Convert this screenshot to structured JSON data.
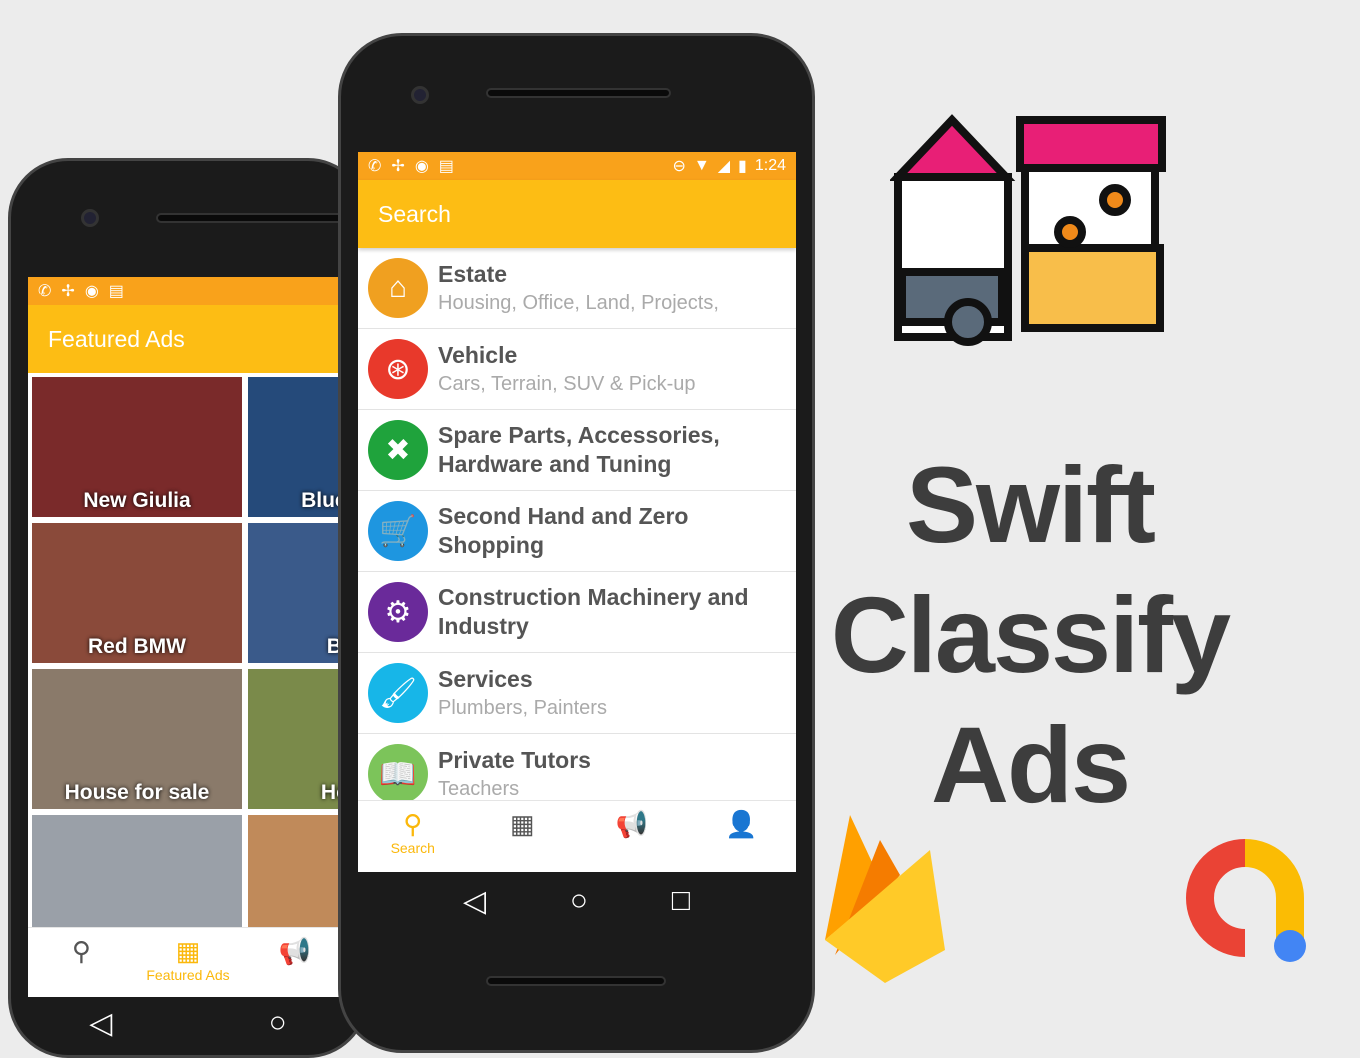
{
  "back_phone": {
    "status_icons": [
      "missed-call-icon",
      "pinwheel-icon",
      "android-icon",
      "news-icon"
    ],
    "appbar_title": "Featured Ads",
    "tiles": [
      {
        "label": "New Giulia",
        "color": "#7a2a2a"
      },
      {
        "label": "Blue BMW",
        "color": "#254a7a"
      },
      {
        "label": "Red BMW",
        "color": "#8a4a3a"
      },
      {
        "label": "BMW",
        "color": "#3a5a8a"
      },
      {
        "label": "House for sale",
        "color": "#8a7a6a"
      },
      {
        "label": "House",
        "color": "#7a8a4a"
      },
      {
        "label": "",
        "color": "#9aa0a8"
      },
      {
        "label": "",
        "color": "#c08a5a"
      }
    ],
    "nav": [
      {
        "icon": "search-icon",
        "label": ""
      },
      {
        "icon": "dashboard-icon",
        "label": "Featured Ads"
      },
      {
        "icon": "megaphone-icon",
        "label": ""
      }
    ]
  },
  "front_phone": {
    "status_icons": [
      "missed-call-icon",
      "pinwheel-icon",
      "android-icon",
      "news-icon"
    ],
    "time": "1:24",
    "appbar_title": "Search",
    "categories": [
      {
        "title": "Estate",
        "subtitle": "Housing, Office, Land, Projects,",
        "icon": "house-icon",
        "color": "#f0a020"
      },
      {
        "title": "Vehicle",
        "subtitle": "Cars, Terrain, SUV & Pick-up",
        "icon": "steering-wheel-icon",
        "color": "#e8392b"
      },
      {
        "title": "Spare Parts, Accessories, Hardware and Tuning",
        "subtitle": "",
        "icon": "tools-icon",
        "color": "#1fa33c"
      },
      {
        "title": "Second Hand and Zero Shopping",
        "subtitle": "",
        "icon": "cart-icon",
        "color": "#1e96e0"
      },
      {
        "title": "Construction Machinery and Industry",
        "subtitle": "",
        "icon": "tractor-icon",
        "color": "#6a2a9a"
      },
      {
        "title": "Services",
        "subtitle": "Plumbers, Painters",
        "icon": "paint-roller-icon",
        "color": "#17b6e8"
      },
      {
        "title": "Private Tutors",
        "subtitle": "Teachers",
        "icon": "book-icon",
        "color": "#7cc45a"
      }
    ],
    "nav": [
      {
        "icon": "search-icon",
        "label": "Search"
      },
      {
        "icon": "dashboard-icon",
        "label": ""
      },
      {
        "icon": "megaphone-icon",
        "label": ""
      },
      {
        "icon": "person-icon",
        "label": ""
      }
    ]
  },
  "title_lines": [
    "Swift",
    "Classify",
    "Ads"
  ],
  "colors": {
    "accent": "#fdbd14",
    "status": "#f9a21b",
    "title": "#3d3d3d"
  }
}
